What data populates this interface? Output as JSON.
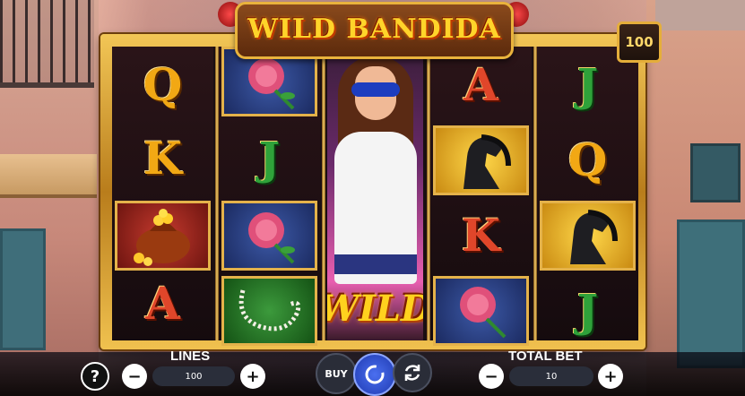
{
  "game": {
    "title": "WILD BANDIDA",
    "ways_badge": "100"
  },
  "reels": [
    [
      {
        "symbol": "Q",
        "kind": "letter",
        "color": "gold"
      },
      {
        "symbol": "K",
        "kind": "letter",
        "color": "gold"
      },
      {
        "symbol": "money-bag",
        "kind": "icon",
        "color": "red"
      },
      {
        "symbol": "A",
        "kind": "letter",
        "color": "red"
      }
    ],
    [
      {
        "symbol": "rose",
        "kind": "icon",
        "color": "blue"
      },
      {
        "symbol": "J",
        "kind": "letter",
        "color": "green"
      },
      {
        "symbol": "rose",
        "kind": "icon",
        "color": "blue"
      },
      {
        "symbol": "pearl-necklace",
        "kind": "icon",
        "color": "green"
      }
    ],
    [
      {
        "symbol": "wild-bandida",
        "kind": "stacked-wild",
        "label": "WILD"
      }
    ],
    [
      {
        "symbol": "A",
        "kind": "letter",
        "color": "red"
      },
      {
        "symbol": "horse",
        "kind": "icon",
        "color": "gold"
      },
      {
        "symbol": "K",
        "kind": "letter",
        "color": "red"
      },
      {
        "symbol": "rose",
        "kind": "icon",
        "color": "blue"
      }
    ],
    [
      {
        "symbol": "J",
        "kind": "letter",
        "color": "green"
      },
      {
        "symbol": "Q",
        "kind": "letter",
        "color": "gold"
      },
      {
        "symbol": "horse",
        "kind": "icon",
        "color": "gold"
      },
      {
        "symbol": "J",
        "kind": "letter",
        "color": "green"
      }
    ]
  ],
  "controls": {
    "help_label": "?",
    "lines_label": "LINES",
    "lines_value": "100",
    "buy_label": "BUY",
    "total_bet_label": "TOTAL BET",
    "total_bet_value": "10",
    "minus": "−",
    "plus": "+"
  },
  "colors": {
    "frame_gold": "#e9b33c",
    "spin_blue": "#3a5be0",
    "title_yellow": "#ffd42a"
  }
}
